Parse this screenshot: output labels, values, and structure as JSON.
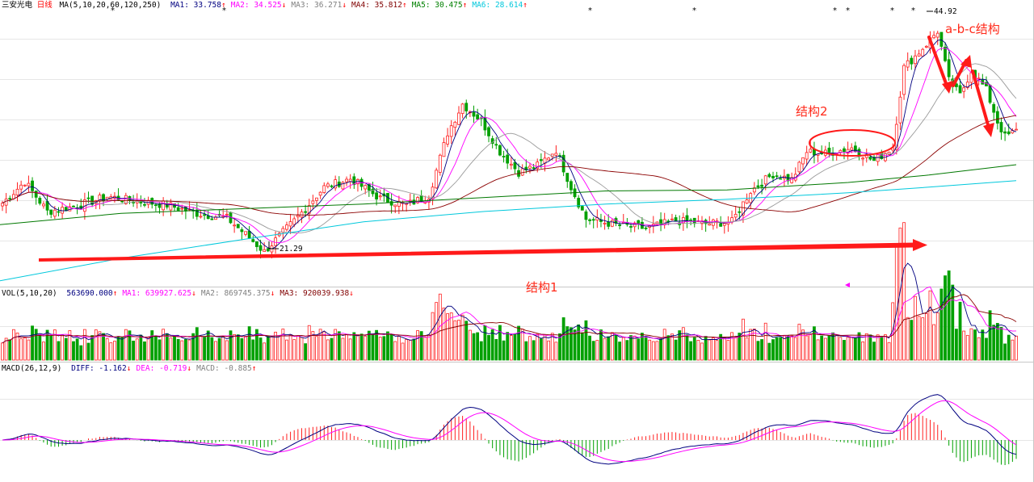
{
  "chart_data": [
    {
      "type": "candlestick",
      "panel": "price",
      "stock_name": "三安光电",
      "period": "日线",
      "ma_label": "MA(5,10,20,60,120,250)",
      "indicators": [
        {
          "label": "MA1: 33.758",
          "arrow": "↑",
          "color": "#000080"
        },
        {
          "label": "MA2: 34.525",
          "arrow": "↓",
          "color": "#ff00ff"
        },
        {
          "label": "MA3: 36.271",
          "arrow": "↓",
          "color": "#808080"
        },
        {
          "label": "MA4: 35.812",
          "arrow": "↑",
          "color": "#800000"
        },
        {
          "label": "MA5: 30.475",
          "arrow": "↑",
          "color": "#008000"
        },
        {
          "label": "MA6: 28.614",
          "arrow": "↑",
          "color": "#00c8dc"
        }
      ],
      "price_labels": {
        "high": "44.92",
        "low": "21.29"
      },
      "ylim": [
        18,
        47
      ],
      "ohlc_anchors": [
        [
          0,
          26.5
        ],
        [
          6,
          28.8
        ],
        [
          12,
          25.6
        ],
        [
          20,
          26.2
        ],
        [
          28,
          27.2
        ],
        [
          34,
          26.8
        ],
        [
          44,
          26.3
        ],
        [
          52,
          25.4
        ],
        [
          60,
          24.9
        ],
        [
          66,
          22.8
        ],
        [
          70,
          21.3
        ],
        [
          78,
          24.6
        ],
        [
          86,
          28.2
        ],
        [
          93,
          29.1
        ],
        [
          101,
          27.0
        ],
        [
          108,
          26.3
        ],
        [
          114,
          27.3
        ],
        [
          119,
          34.0
        ],
        [
          123,
          37.1
        ],
        [
          128,
          35.3
        ],
        [
          133,
          32.0
        ],
        [
          138,
          29.8
        ],
        [
          143,
          30.5
        ],
        [
          148,
          32.2
        ],
        [
          152,
          28.2
        ],
        [
          156,
          24.8
        ],
        [
          164,
          24.2
        ],
        [
          172,
          23.8
        ],
        [
          180,
          24.6
        ],
        [
          188,
          24.3
        ],
        [
          195,
          24.5
        ],
        [
          200,
          27.8
        ],
        [
          206,
          29.6
        ],
        [
          211,
          29.0
        ],
        [
          215,
          32.0
        ],
        [
          220,
          31.8
        ],
        [
          227,
          32.4
        ],
        [
          233,
          31.0
        ],
        [
          238,
          32.5
        ],
        [
          241,
          41.0
        ],
        [
          244,
          42.2
        ],
        [
          247,
          43.5
        ],
        [
          250,
          44.9
        ],
        [
          253,
          39.6
        ],
        [
          256,
          38.0
        ],
        [
          259,
          40.7
        ],
        [
          263,
          38.6
        ],
        [
          266,
          35.2
        ],
        [
          268,
          33.6
        ],
        [
          271,
          34.2
        ]
      ],
      "annotations": [
        {
          "text": "a-b-c结构"
        },
        {
          "text": "结构2"
        },
        {
          "text": "结构1"
        }
      ]
    },
    {
      "type": "bar",
      "panel": "volume",
      "label": "VOL(5,10,20)",
      "indicators": [
        {
          "label": "563690.000",
          "arrow": "↑",
          "color": "#000080"
        },
        {
          "label": "MA1: 639927.625",
          "arrow": "↓",
          "color": "#ff00ff"
        },
        {
          "label": "MA2: 869745.375",
          "arrow": "↓",
          "color": "#808080"
        },
        {
          "label": "MA3: 920039.938",
          "arrow": "↓",
          "color": "#800000"
        }
      ],
      "ylim": [
        0,
        1600000
      ]
    },
    {
      "type": "bar",
      "panel": "macd",
      "label": "MACD(26,12,9)",
      "indicators": [
        {
          "label": "DIFF: -1.162",
          "arrow": "↓",
          "color": "#000080"
        },
        {
          "label": "DEA: -0.719",
          "arrow": "↓",
          "color": "#ff00ff"
        },
        {
          "label": "MACD: -0.885",
          "arrow": "↑",
          "color": "#808080"
        }
      ]
    }
  ]
}
